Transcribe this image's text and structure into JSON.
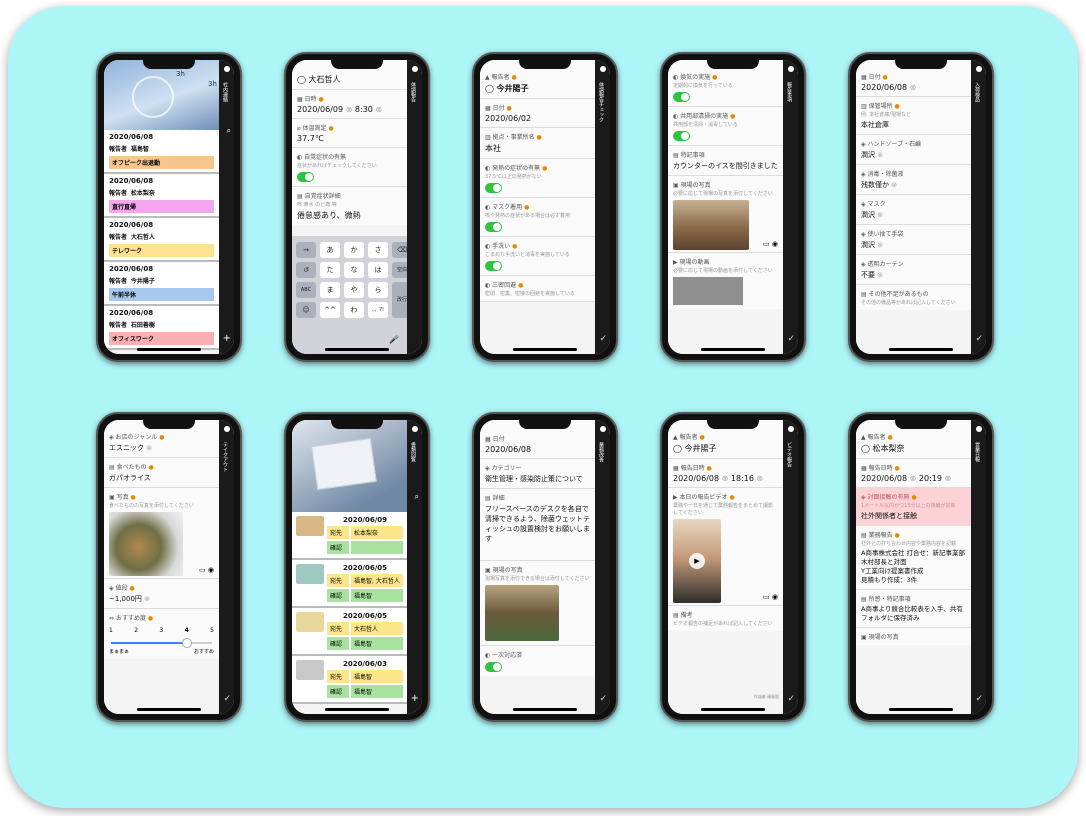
{
  "phones": {
    "p1": {
      "sidebar": "社内連絡",
      "header": {
        "times": [
          "3h",
          "3h"
        ]
      },
      "cards": [
        {
          "date": "2020/06/08",
          "reporter_label": "報告者",
          "reporter": "福島智",
          "tag": "オフピーク出退勤",
          "tag_color": "#f9c48e"
        },
        {
          "date": "2020/06/08",
          "reporter_label": "報告者",
          "reporter": "松本梨奈",
          "tag": "直行直帰",
          "tag_color": "#f2a7ef"
        },
        {
          "date": "2020/06/08",
          "reporter_label": "報告者",
          "reporter": "大石哲人",
          "tag": "テレワーク",
          "tag_color": "#fde391"
        },
        {
          "date": "2020/06/08",
          "reporter_label": "報告者",
          "reporter": "今井陽子",
          "tag": "午前半休",
          "tag_color": "#a7c8ec"
        },
        {
          "date": "2020/06/08",
          "reporter_label": "報告者",
          "reporter": "石田善樹",
          "tag": "オフィスワーク",
          "tag_color": "#f9b0b0"
        }
      ]
    },
    "p2": {
      "sidebar": "体調報告",
      "name": "大石哲人",
      "date_label": "日時",
      "date": "2020/06/09",
      "time": "8:30",
      "temp_label": "体温測定",
      "temp": "37.7℃",
      "selfcheck_label": "自覚症状の有無",
      "selfcheck_hint": "症状があればチェックしてください",
      "symptom_label": "自覚症状詳細",
      "symptom_hint": "咳 鼻水 のど痛 等",
      "symptom_value": "倦怠感あり、微熱",
      "keys": [
        "→",
        "あ",
        "か",
        "さ",
        "⌫",
        "↺",
        "た",
        "な",
        "は",
        "空白",
        "ABC",
        "ま",
        "や",
        "ら",
        "改行",
        "☺",
        "^^",
        "わ",
        "、。?!",
        "🎤"
      ]
    },
    "p3": {
      "sidebar": "体調報告チェック",
      "reporter_label": "報告者",
      "reporter": "今井陽子",
      "date_label": "日付",
      "date": "2020/06/02",
      "office_label": "拠点・事業所名",
      "office": "本社",
      "items": [
        {
          "label": "発熱の症状の有無",
          "hint": "37.5℃以上の発熱がない"
        },
        {
          "label": "マスク着用",
          "hint": "咳や発熱の症状がある場合は必ず着用"
        },
        {
          "label": "手洗い",
          "hint": "こまめな手洗いと消毒を実施している"
        },
        {
          "label": "三密回避",
          "hint": "密閉、密集、密接の回避を実施している"
        }
      ]
    },
    "p4": {
      "sidebar": "報告事項",
      "items": [
        {
          "label": "換気の実施",
          "hint": "定期的に換気を行っている"
        },
        {
          "label": "共用部清掃の実施",
          "hint": "共用部を清掃・消毒している"
        }
      ],
      "special_label": "特記事項",
      "special_value": "カウンターのイスを間引きました",
      "photo_label": "現場の写真",
      "photo_hint": "必要に応じて現場の写真を添付してください",
      "video_label": "現場の動画",
      "video_hint": "必要に応じて現場の動画を添付してください"
    },
    "p5": {
      "sidebar": "入荷検品",
      "date_label": "日付",
      "date": "2020/06/08",
      "place_label": "保管場所",
      "place_hint": "例: 本社倉庫/現場など",
      "place": "本社倉庫",
      "rows": [
        {
          "label": "ハンドソープ・石鹸",
          "value": "潤沢"
        },
        {
          "label": "消毒・除菌液",
          "value": "残数僅か"
        },
        {
          "label": "マスク",
          "value": "潤沢"
        },
        {
          "label": "使い捨て手袋",
          "value": "潤沢"
        },
        {
          "label": "透明カーテン",
          "value": "不要"
        }
      ],
      "other_label": "その他不足があるもの",
      "other_hint": "その他の備品等があれば記入してください"
    },
    "p6": {
      "sidebar": "テイクアウト",
      "genre_label": "お店のジャンル",
      "genre": "エスニック",
      "food_label": "食べたもの",
      "food": "ガパオライス",
      "photo_label": "写真",
      "photo_hint": "食べたものの写真を添付してください",
      "price_label": "値段",
      "price": "~1,000円",
      "rating_label": "おすすめ度",
      "rating_ticks": [
        "1",
        "2",
        "3",
        "4",
        "5"
      ],
      "rating_value": 4,
      "rating_low": "まぁまぁ",
      "rating_high": "おすすめ"
    },
    "p7": {
      "sidebar": "書類回覧",
      "entries": [
        {
          "date": "2020/06/09",
          "to_label": "宛先",
          "to": "松本梨奈",
          "check_label": "確認",
          "check": ""
        },
        {
          "date": "2020/06/05",
          "to_label": "宛先",
          "to": "福島智, 大石哲人",
          "check_label": "確認",
          "check": "福島智"
        },
        {
          "date": "2020/06/05",
          "to_label": "宛先",
          "to": "大石哲人",
          "check_label": "確認",
          "check": "福島智"
        },
        {
          "date": "2020/06/03",
          "to_label": "宛先",
          "to": "福島智",
          "check_label": "確認",
          "check": "福島智"
        }
      ]
    },
    "p8": {
      "sidebar": "業務改善",
      "date_label": "日付",
      "date": "2020/06/08",
      "cat_label": "カテゴリー",
      "cat": "衛生管理・感染防止策について",
      "detail_label": "詳細",
      "detail": "フリースペースのデスクを各自で清掃できるよう、除菌ウェットティッシュの設置検討をお願いします",
      "photo_label": "現場の写真",
      "photo_hint": "現場写真を添付できる場合は添付してください",
      "done_label": "一次対応済"
    },
    "p9": {
      "sidebar": "ビデオ報告",
      "reporter_label": "報告者",
      "reporter": "今井陽子",
      "date_label": "報告日時",
      "date": "2020/06/08",
      "time": "18:16",
      "video_label": "本日の報告ビデオ",
      "video_hint": "業務や一日を通じて業務報告をまとめて撮影してください",
      "note_label": "備考",
      "note_hint": "ビデオ報告の補足があれば記入してください",
      "footer": "作成者 福島智"
    },
    "p10": {
      "sidebar": "営業日報",
      "reporter_label": "報告者",
      "reporter": "松本梨奈",
      "date_label": "報告日時",
      "date": "2020/06/08",
      "time": "20:19",
      "contact_label": "対面接触の有無",
      "contact_hint": "1メートル以内かつ15分以上の接触が対象",
      "contact": "社外関係者と接触",
      "work_label": "業務報告",
      "work_hint": "社外との打ち合わせ内容や業務内容を記載",
      "work": "A商事株式会社 打合せ：新記事業部 木村部長と対面\nY工業向け提案書作成\n見積もり作成：3件",
      "next_label": "所感・特記事項",
      "next": "A商事より競合比較表を入手、共有フォルダに保存済み",
      "photo_label": "現場の写真"
    }
  }
}
